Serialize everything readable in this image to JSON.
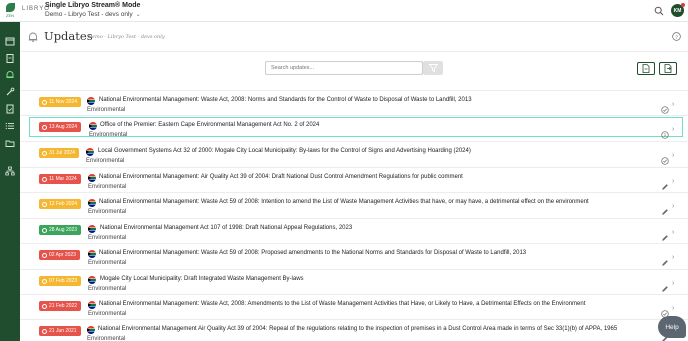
{
  "app": {
    "brand": "LIBRYO",
    "logo_caption": "ZEN",
    "title": "Single Libryo Stream® Mode",
    "subtitle": "Demo - Libryo Test - devs only",
    "avatar_initials": "KM"
  },
  "page": {
    "title": "Updates",
    "subtitle": "Demo - Libryo Test - devs only"
  },
  "search": {
    "placeholder": "Search updates..."
  },
  "colors": {
    "rail": "#1f4d2e",
    "badge_orange": "#f5b731",
    "badge_red": "#e5534b",
    "badge_green": "#3ba55c",
    "selected_outline": "#6fe0c8"
  },
  "updates": [
    {
      "date": "11 Nov 2024",
      "badge": "orange",
      "title": "National Environmental Management: Waste Act, 2008: Norms and Standards for the Control of Waste to Disposal of Waste to Landfill, 2013",
      "category": "Environmental",
      "status_icon": "check-circle-icon"
    },
    {
      "date": "13 Aug 2024",
      "badge": "red",
      "title": "Office of the Premier: Eastern Cape Environmental Management Act No. 2 of 2024",
      "category": "Environmental",
      "status_icon": "info-circle-icon"
    },
    {
      "date": "31 Jul 2024",
      "badge": "orange",
      "title": "Local Government Systems Act 32 of 2000: Mogale City Local Municipality: By-laws for the Control of Signs and Advertising Hoarding (2024)",
      "category": "Environmental",
      "status_icon": "check-circle-icon"
    },
    {
      "date": "11 Mar 2024",
      "badge": "red",
      "title": "National Environmental Management: Air Quality Act 39 of 2004: Draft National Dust Control Amendment Regulations for public comment",
      "category": "Environmental",
      "status_icon": "pencil-icon"
    },
    {
      "date": "12 Feb 2024",
      "badge": "orange",
      "title": "National Environmental Management: Waste Act 59 of 2008: Intention to amend the List of Waste Management Activities that have, or may have, a detrimental effect on the environment",
      "category": "Environmental",
      "status_icon": "pencil-icon"
    },
    {
      "date": "28 Aug 2023",
      "badge": "green",
      "title": "National Environmental Management Act 107 of 1998: Draft National Appeal Regulations, 2023",
      "category": "Environmental",
      "status_icon": "pencil-icon"
    },
    {
      "date": "02 Apr 2023",
      "badge": "red",
      "title": "National Environmental Management: Waste Act 59 of 2008: Proposed amendments to the National Norms and Standards for Disposal of Waste to Landfill, 2013",
      "category": "Environmental",
      "status_icon": "pencil-icon"
    },
    {
      "date": "07 Feb 2023",
      "badge": "orange",
      "title": "Mogale City Local Municipality: Draft Integrated Waste Management By-laws",
      "category": "Environmental",
      "status_icon": "pencil-icon"
    },
    {
      "date": "21 Feb 2022",
      "badge": "red",
      "title": "National Environmental Management: Waste Act, 2008: Amendments to the List of Waste Management Activities that Have, or Likely to Have, a Detrimental Effects on the Environment",
      "category": "Environmental",
      "status_icon": "check-circle-icon"
    },
    {
      "date": "21 Jun 2021",
      "badge": "red",
      "title": "National Environmental Management Air Quality Act 39 of 2004: Repeal of the regulations relating to the inspection of premises in a Dust Control Area made in terms of Sec 33(1)(b) of APPA, 1965",
      "category": "Environmental",
      "status_icon": "pencil-icon"
    }
  ],
  "help_label": "Help"
}
